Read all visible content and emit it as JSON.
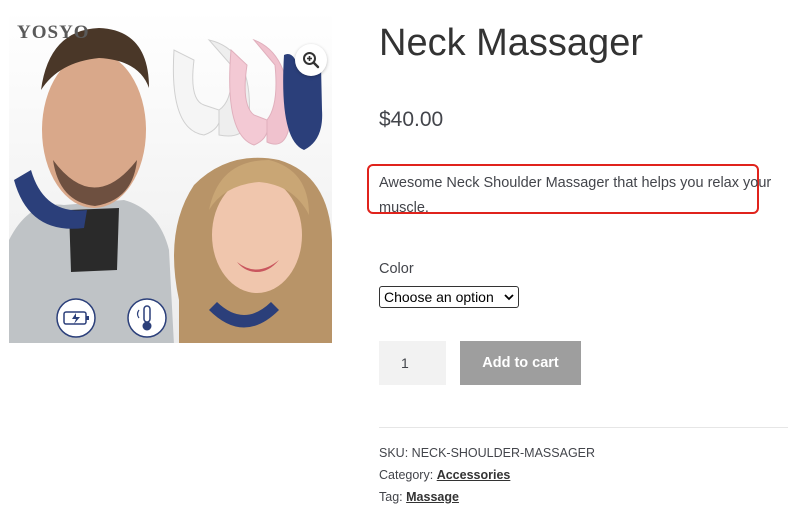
{
  "product": {
    "title": "Neck Massager",
    "price": "$40.00",
    "description": "Awesome Neck Shoulder Massager that helps you relax your muscle.",
    "image": {
      "brand_watermark": "YOSYO",
      "zoom_icon": "magnifier-plus-icon",
      "feature_icons": [
        "battery-icon",
        "thermometer-icon"
      ]
    }
  },
  "variations": {
    "color_label": "Color",
    "color_select_value": "Choose an option"
  },
  "cart": {
    "quantity": "1",
    "add_to_cart_label": "Add to cart"
  },
  "meta": {
    "sku_label": "SKU:",
    "sku_value": "NECK-SHOULDER-MASSAGER",
    "category_label": "Category:",
    "category_value": "Accessories",
    "tag_label": "Tag:",
    "tag_value": "Massage"
  },
  "colors": {
    "highlight_border": "#e0231c",
    "button_bg": "#9e9e9e",
    "qty_bg": "#f2f2f2",
    "massager_navy": "#2b3f7a",
    "massager_pink": "#f3c9d4",
    "massager_white": "#f5f5f5"
  }
}
